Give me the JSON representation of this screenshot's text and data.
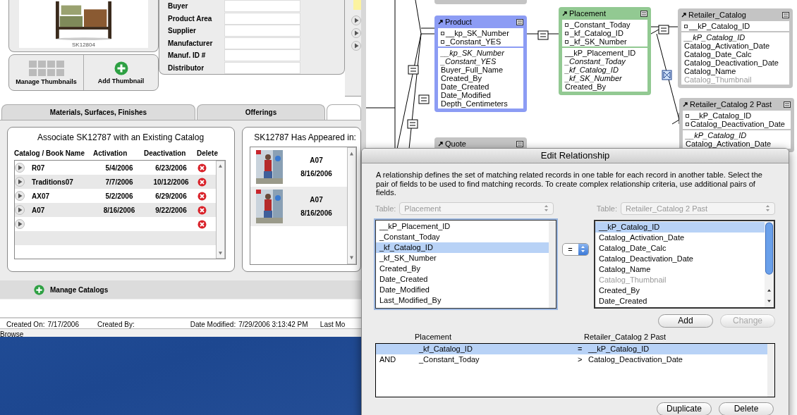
{
  "product_window": {
    "photo_caption": "SK12804",
    "thumbnail_buttons": [
      {
        "label": "Manage Thumbnails",
        "kind": "grid"
      },
      {
        "label": "Add Thumbnail",
        "kind": "add"
      }
    ],
    "fields": [
      {
        "label": "Buyer"
      },
      {
        "label": "Product Area"
      },
      {
        "label": "Supplier"
      },
      {
        "label": "Manufacturer"
      },
      {
        "label": "Manuf. ID #"
      },
      {
        "label": "Distributor"
      }
    ],
    "tabs": [
      {
        "label": "Materials, Surfaces, Finishes",
        "selected": false
      },
      {
        "label": "Offerings",
        "selected": false
      },
      {
        "selected": true
      }
    ],
    "catalog_panel": {
      "title": "Associate SK12787 with an Existing Catalog",
      "columns": [
        "Catalog / Book Name",
        "Activation",
        "Deactivation",
        "Delete"
      ],
      "rows": [
        {
          "kind": "entry",
          "name": "R07",
          "activation": "5/4/2006",
          "deactivation": "6/23/2006"
        },
        {
          "kind": "entry",
          "name": "Traditions07",
          "activation": "7/7/2006",
          "deactivation": "10/12/2006"
        },
        {
          "kind": "entry",
          "name": "AX07",
          "activation": "5/2/2006",
          "deactivation": "6/29/2006"
        },
        {
          "kind": "entry",
          "name": "A07",
          "activation": "8/16/2006",
          "deactivation": "9/22/2006"
        },
        {
          "kind": "blank"
        }
      ]
    },
    "appeared_panel": {
      "title": "SK12787 Has Appeared in:",
      "items": [
        {
          "catalog": "A07",
          "date": "8/16/2006"
        },
        {
          "catalog": "A07",
          "date": "8/16/2006"
        }
      ]
    },
    "manage_catalogs": "Manage Catalogs",
    "footer": [
      {
        "label": "Created On:",
        "value": "7/17/2006"
      },
      {
        "label": "Created By:"
      },
      {
        "label": "Date Modified:",
        "value": "7/29/2006 3:13:42 PM"
      },
      {
        "label": "Last Mo"
      }
    ],
    "mode": "Browse"
  },
  "relationship_graph": {
    "tables": [
      {
        "kind": "stub",
        "color": "#c4c4c4"
      },
      {
        "kind": "table",
        "name": "Product",
        "color": "#8c9cf4",
        "keys": [
          "__kp_SK_Number",
          "_Constant_YES"
        ],
        "fields": [
          {
            "name": "__kp_SK_Number",
            "kind": "match"
          },
          {
            "name": "_Constant_YES",
            "kind": "match"
          },
          {
            "name": "Buyer_Full_Name",
            "kind": "plain"
          },
          {
            "name": "Created_By",
            "kind": "plain"
          },
          {
            "name": "Date_Created",
            "kind": "plain"
          },
          {
            "name": "Date_Modified",
            "kind": "plain"
          },
          {
            "name": "Depth_Centimeters",
            "kind": "plain"
          }
        ]
      },
      {
        "kind": "table",
        "name": "Placement",
        "color": "#92c992",
        "keys": [
          "_Constant_Today",
          "_kf_Catalog_ID",
          "_kf_SK_Number"
        ],
        "fields": [
          {
            "name": "__kP_Placement_ID",
            "kind": "plain"
          },
          {
            "name": "_Constant_Today",
            "kind": "match"
          },
          {
            "name": "_kf_Catalog_ID",
            "kind": "match"
          },
          {
            "name": "_kf_SK_Number",
            "kind": "match"
          },
          {
            "name": "Created_By",
            "kind": "plain"
          }
        ]
      },
      {
        "kind": "table",
        "name": "Retailer_Catalog",
        "color": "#c4c4c4",
        "keys": [
          "__kP_Catalog_ID"
        ],
        "fields": [
          {
            "name": "__kP_Catalog_ID",
            "kind": "match"
          },
          {
            "name": "Catalog_Activation_Date",
            "kind": "plain"
          },
          {
            "name": "Catalog_Date_Calc",
            "kind": "plain"
          },
          {
            "name": "Catalog_Deactivation_Date",
            "kind": "plain"
          },
          {
            "name": "Catalog_Name",
            "kind": "plain"
          },
          {
            "name": "Catalog_Thumbnail",
            "kind": "dim"
          }
        ]
      },
      {
        "kind": "table",
        "name": "Quote",
        "color": "#c4c4c4"
      },
      {
        "kind": "table",
        "name": "Retailer_Catalog 2 Past",
        "color": "#c4c4c4",
        "keys": [
          "__kP_Catalog_ID",
          "Catalog_Deactivation_Date"
        ],
        "fields": [
          {
            "name": "__kP_Catalog_ID",
            "kind": "match"
          },
          {
            "name": "Catalog_Activation_Date",
            "kind": "plain"
          }
        ]
      }
    ]
  },
  "dialog": {
    "title": "Edit Relationship",
    "description": "A relationship defines the set of matching related records in one table for each record in another table. Select the pair of fields to be used to find matching records. To create complex relationship criteria, use additional pairs of fields.",
    "left_table": {
      "label": "Table:",
      "value": "Placement",
      "disabled": true
    },
    "right_table": {
      "label": "Table:",
      "value": "Retailer_Catalog 2 Past",
      "disabled": true
    },
    "left_fields": [
      {
        "name": "__kP_Placement_ID",
        "selected": false,
        "disabled": false
      },
      {
        "name": "_Constant_Today",
        "selected": false,
        "disabled": false
      },
      {
        "name": "_kf_Catalog_ID",
        "selected": true,
        "disabled": false
      },
      {
        "name": "_kf_SK_Number",
        "selected": false,
        "disabled": false
      },
      {
        "name": "Created_By",
        "selected": false,
        "disabled": false
      },
      {
        "name": "Date_Created",
        "selected": false,
        "disabled": false
      },
      {
        "name": "Date_Modified",
        "selected": false,
        "disabled": false
      },
      {
        "name": "Last_Modified_By",
        "selected": false,
        "disabled": false
      }
    ],
    "operator": "=",
    "right_fields": [
      {
        "name": "__kP_Catalog_ID",
        "selected": true,
        "disabled": false
      },
      {
        "name": "Catalog_Activation_Date",
        "selected": false,
        "disabled": false
      },
      {
        "name": "Catalog_Date_Calc",
        "selected": false,
        "disabled": false
      },
      {
        "name": "Catalog_Deactivation_Date",
        "selected": false,
        "disabled": false
      },
      {
        "name": "Catalog_Name",
        "selected": false,
        "disabled": false
      },
      {
        "name": "Catalog_Thumbnail",
        "selected": false,
        "disabled": true
      },
      {
        "name": "Created_By",
        "selected": false,
        "disabled": false
      },
      {
        "name": "Date_Created",
        "selected": false,
        "disabled": false
      }
    ],
    "middle_buttons": [
      {
        "label": "Add",
        "disabled": false
      },
      {
        "label": "Change",
        "disabled": true
      }
    ],
    "criteria_headers": [
      "Placement",
      "Retailer_Catalog 2 Past"
    ],
    "criteria": [
      {
        "left": "_kf_Catalog_ID",
        "operator": "=",
        "right": "__kP_Catalog_ID",
        "selected": true
      },
      {
        "conjunction": "AND",
        "left": "_Constant_Today",
        "operator": ">",
        "right": "Catalog_Deactivation_Date",
        "selected": false
      }
    ],
    "bottom_buttons": [
      {
        "label": "Duplicate",
        "disabled": false
      },
      {
        "label": "Delete",
        "disabled": false
      }
    ]
  }
}
